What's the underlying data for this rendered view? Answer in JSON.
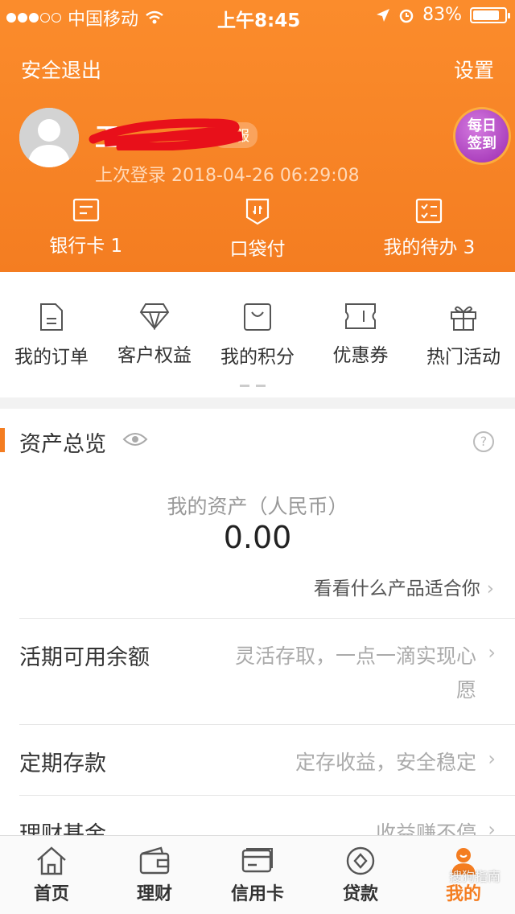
{
  "status": {
    "carrier": "中国移动",
    "time": "上午8:45",
    "battery": "83%",
    "battery_level": 0.83
  },
  "header": {
    "logout_label": "安全退出",
    "settings_label": "设置",
    "username": "王",
    "service_badge": "客服",
    "last_login": "上次登录 2018-04-26 06:29:08",
    "checkin_line1": "每日",
    "checkin_line2": "签到"
  },
  "quick_actions": [
    {
      "label": "银行卡  1"
    },
    {
      "label": "口袋付"
    },
    {
      "label": "我的待办  3"
    }
  ],
  "menu": [
    {
      "label": "我的订单"
    },
    {
      "label": "客户权益"
    },
    {
      "label": "我的积分"
    },
    {
      "label": "优惠券"
    },
    {
      "label": "热门活动"
    }
  ],
  "assets": {
    "title": "资产总览",
    "label": "我的资产（人民币）",
    "value": "0.00",
    "suggest": "看看什么产品适合你"
  },
  "rows": [
    {
      "label": "活期可用余额",
      "value_line1": "灵活存取，一点一滴实现心",
      "value_line2": "愿"
    },
    {
      "label": "定期存款",
      "value_line1": "定存收益，安全稳定"
    },
    {
      "label": "理财基金",
      "value_line1": "收益赚不停"
    }
  ],
  "tabs": [
    {
      "label": "首页"
    },
    {
      "label": "理财"
    },
    {
      "label": "信用卡"
    },
    {
      "label": "贷款"
    },
    {
      "label": "我的"
    }
  ],
  "watermark": "搜狗指南",
  "colors": {
    "accent": "#f47d21",
    "checkin": "#9b2ab0"
  }
}
